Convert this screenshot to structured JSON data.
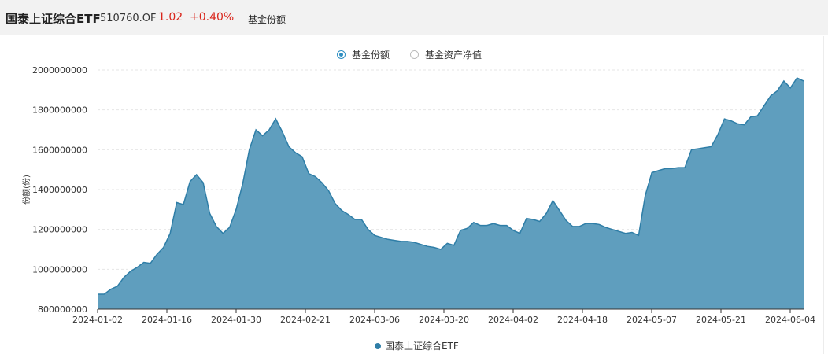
{
  "header": {
    "fund_name": "国泰上证综合ETF",
    "fund_code": "510760.OF",
    "price": "1.02",
    "change": "+0.40%",
    "tab_label": "基金份额"
  },
  "toggles": [
    {
      "label": "基金份额",
      "checked": true
    },
    {
      "label": "基金资产净值",
      "checked": false
    }
  ],
  "colors": {
    "area_fill": "#5f9ebe",
    "line": "#2f7ea7",
    "up": "#d9261c"
  },
  "chart_data": {
    "type": "area",
    "ylabel": "份额(份)",
    "ylim": [
      800000000,
      2000000000
    ],
    "yticks": [
      "2000000000",
      "1800000000",
      "1600000000",
      "1400000000",
      "1200000000",
      "1000000000",
      "800000000"
    ],
    "xticks": [
      "2024-01-02",
      "2024-01-16",
      "2024-01-30",
      "2024-02-21",
      "2024-03-06",
      "2024-03-20",
      "2024-04-02",
      "2024-04-18",
      "2024-05-07",
      "2024-05-21",
      "2024-06-04"
    ],
    "grid": true,
    "legend_position": "bottom",
    "series": [
      {
        "name": "国泰上证综合ETF",
        "values": [
          875000000,
          875000000,
          900000000,
          915000000,
          960000000,
          990000000,
          1010000000,
          1035000000,
          1030000000,
          1075000000,
          1110000000,
          1180000000,
          1335000000,
          1325000000,
          1440000000,
          1475000000,
          1435000000,
          1280000000,
          1215000000,
          1180000000,
          1210000000,
          1300000000,
          1430000000,
          1600000000,
          1700000000,
          1670000000,
          1700000000,
          1755000000,
          1690000000,
          1615000000,
          1585000000,
          1565000000,
          1480000000,
          1465000000,
          1435000000,
          1395000000,
          1330000000,
          1295000000,
          1275000000,
          1250000000,
          1250000000,
          1200000000,
          1170000000,
          1160000000,
          1150000000,
          1145000000,
          1140000000,
          1140000000,
          1135000000,
          1125000000,
          1115000000,
          1110000000,
          1100000000,
          1130000000,
          1120000000,
          1195000000,
          1205000000,
          1235000000,
          1220000000,
          1220000000,
          1230000000,
          1220000000,
          1220000000,
          1195000000,
          1180000000,
          1255000000,
          1250000000,
          1240000000,
          1280000000,
          1345000000,
          1295000000,
          1245000000,
          1215000000,
          1215000000,
          1230000000,
          1230000000,
          1225000000,
          1210000000,
          1200000000,
          1190000000,
          1180000000,
          1185000000,
          1170000000,
          1370000000,
          1485000000,
          1495000000,
          1505000000,
          1505000000,
          1510000000,
          1510000000,
          1600000000,
          1605000000,
          1610000000,
          1615000000,
          1675000000,
          1755000000,
          1745000000,
          1730000000,
          1725000000,
          1765000000,
          1770000000,
          1820000000,
          1870000000,
          1895000000,
          1945000000,
          1910000000,
          1960000000,
          1945000000
        ]
      }
    ]
  }
}
